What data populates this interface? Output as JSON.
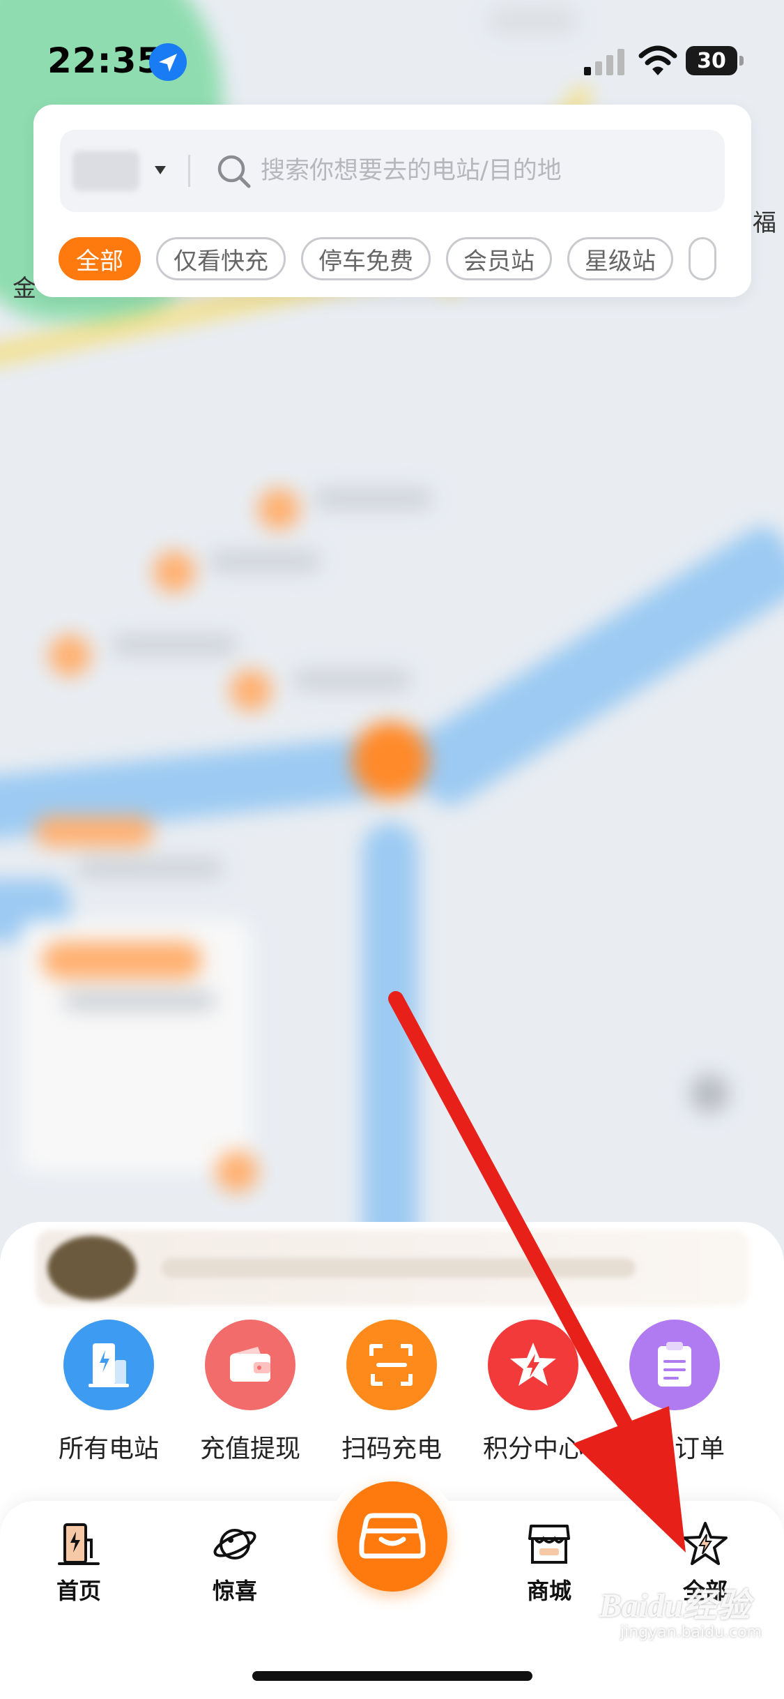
{
  "status_bar": {
    "time": "22:35",
    "battery": "30",
    "icons": [
      "location-arrow-icon",
      "cellular-signal-icon",
      "wifi-icon",
      "battery-icon"
    ]
  },
  "map": {
    "labels": [
      "福",
      "金"
    ]
  },
  "search": {
    "placeholder": "搜索你想要去的电站/目的地",
    "icon": "search-icon"
  },
  "filters": [
    {
      "label": "全部",
      "active": true
    },
    {
      "label": "仅看快充",
      "active": false
    },
    {
      "label": "停车免费",
      "active": false
    },
    {
      "label": "会员站",
      "active": false
    },
    {
      "label": "星级站",
      "active": false
    }
  ],
  "quick_actions": [
    {
      "label": "所有电站",
      "icon": "power-station-icon",
      "color": "#3d9bf2"
    },
    {
      "label": "充值提现",
      "icon": "wallet-icon",
      "color": "#f26c6c"
    },
    {
      "label": "扫码充电",
      "icon": "scan-icon",
      "color": "#ff8a1c"
    },
    {
      "label": "积分中心",
      "icon": "star-bolt-icon",
      "color": "#f23a3a"
    },
    {
      "label": "充电订单",
      "icon": "order-clipboard-icon",
      "color": "#b07af0"
    }
  ],
  "tabs": [
    {
      "label": "首页",
      "icon": "charger-home-icon"
    },
    {
      "label": "惊喜",
      "icon": "planet-icon"
    },
    {
      "label": "",
      "icon": "car-icon"
    },
    {
      "label": "商城",
      "icon": "store-icon"
    },
    {
      "label": "全部",
      "icon": "star-bolt-outline-icon"
    }
  ],
  "colors": {
    "accent": "#ff7a0e",
    "annotation_arrow": "#e8201a"
  },
  "watermark": {
    "main": "Baidu经验",
    "sub": "jingyan.baidu.com"
  }
}
